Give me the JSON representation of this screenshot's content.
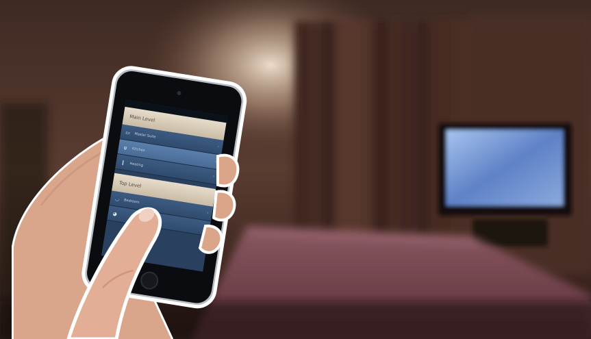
{
  "phone_app": {
    "main_section": {
      "header": "Main Level",
      "items": [
        {
          "label": "Master Suite",
          "icon": "bed-icon"
        },
        {
          "label": "Kitchen",
          "icon": "fork-icon"
        },
        {
          "label": "Heating",
          "icon": "thermometer-icon"
        }
      ]
    },
    "top_section": {
      "header": "Top Level",
      "items": [
        {
          "label": "Bedroom",
          "icon": "bathtub-icon"
        },
        {
          "label": "",
          "icon": "bear-icon"
        }
      ]
    },
    "selected_row": "Kitchen"
  },
  "palette": {
    "wall": "#3b2620",
    "curtain": "#4a2d24",
    "tv_screen": "#6f8fd0",
    "bedspread": "#7a4650",
    "phone_list": "#2f4b6e",
    "section_header": "#d8ccb8"
  }
}
